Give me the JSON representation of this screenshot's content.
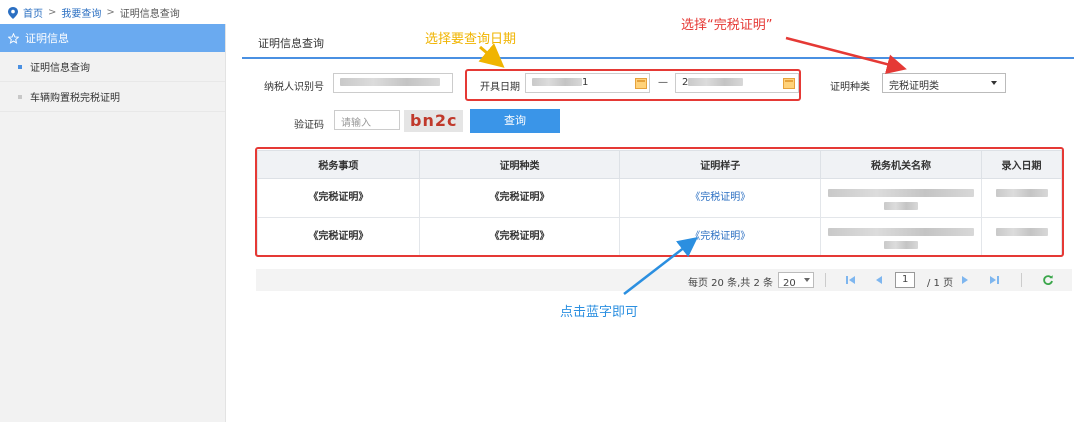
{
  "breadcrumb": {
    "home": "首页",
    "query": "我要查询",
    "current": "证明信息查询",
    "sep": ">"
  },
  "sidebar": {
    "header": "证明信息",
    "items": [
      {
        "label": "证明信息查询"
      },
      {
        "label": "车辆购置税完税证明"
      }
    ]
  },
  "main": {
    "title": "证明信息查询",
    "form": {
      "taxpayer_id_label": "纳税人识别号",
      "start_date_label": "开具日期",
      "date_start_suffix": "1",
      "date_sep": "—",
      "date_end_prefix": "2",
      "cert_type_label": "证明种类",
      "cert_type_value": "完税证明类",
      "captcha_label": "验证码",
      "captcha_placeholder": "请输入",
      "captcha_text": "bn2c",
      "query_button": "查询"
    },
    "table": {
      "headers": [
        "税务事项",
        "证明种类",
        "证明样子",
        "税务机关名称",
        "录入日期"
      ],
      "rows": [
        {
          "item": "《完税证明》",
          "type": "《完税证明》",
          "sample": "《完税证明》"
        },
        {
          "item": "《完税证明》",
          "type": "《完税证明》",
          "sample": "《完税证明》"
        }
      ]
    },
    "pager": {
      "summary": "每页 20 条,共 2 条",
      "page_size": "20",
      "page_input": "1",
      "page_total": "/ 1 页"
    }
  },
  "annotations": {
    "date_note": "选择要查询日期",
    "type_note": "选择“完税证明”",
    "click_note": "点击蓝字即可"
  },
  "colors": {
    "accent": "#4a90e2",
    "sidebar_active": "#6aaaf0",
    "annotation_red": "#e53935",
    "annotation_orange": "#f0b400",
    "annotation_blue": "#2b8fe0",
    "link": "#2b6fc2"
  }
}
